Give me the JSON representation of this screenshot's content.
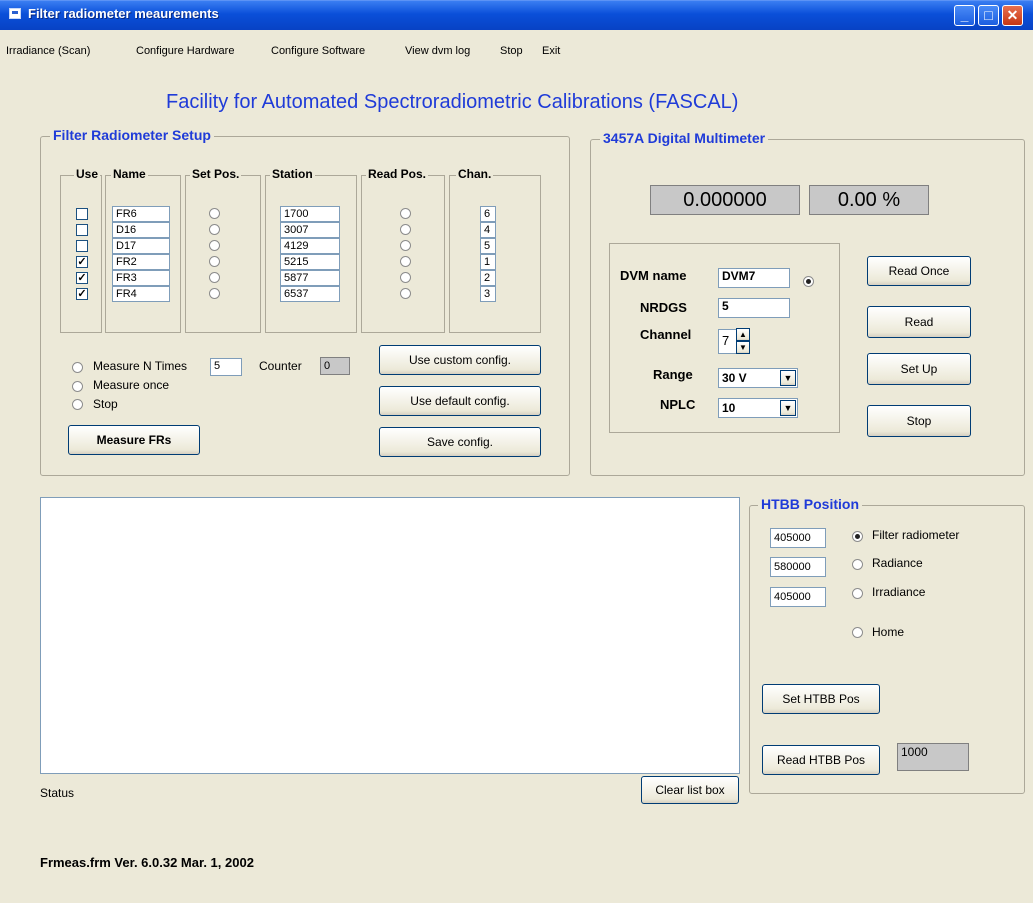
{
  "window": {
    "title": "Filter radiometer meaurements"
  },
  "menu": [
    "Irradiance (Scan)",
    "Configure Hardware",
    "Configure Software",
    "View dvm log",
    "Stop",
    "Exit"
  ],
  "main_title": "Facility for Automated Spectroradiometric Calibrations (FASCAL)",
  "fr_setup": {
    "title": "Filter Radiometer Setup",
    "headers": {
      "use": "Use",
      "name": "Name",
      "set_pos": "Set Pos.",
      "station": "Station",
      "read_pos": "Read Pos.",
      "chan": "Chan."
    },
    "rows": [
      {
        "use": false,
        "name": "FR6",
        "station": "1700",
        "chan": "6"
      },
      {
        "use": false,
        "name": "D16",
        "station": "3007",
        "chan": "4"
      },
      {
        "use": false,
        "name": "D17",
        "station": "4129",
        "chan": "5"
      },
      {
        "use": true,
        "name": "FR2",
        "station": "5215",
        "chan": "1"
      },
      {
        "use": true,
        "name": "FR3",
        "station": "5877",
        "chan": "2"
      },
      {
        "use": true,
        "name": "FR4",
        "station": "6537",
        "chan": "3"
      }
    ],
    "measure_n_label": "Measure N Times",
    "measure_n_value": "5",
    "counter_label": "Counter",
    "counter_value": "0",
    "measure_once_label": "Measure once",
    "stop_label": "Stop",
    "measure_button": "Measure FRs",
    "custom_config_button": "Use custom config.",
    "default_config_button": "Use default config.",
    "save_config_button": "Save config."
  },
  "dmm": {
    "title": "3457A Digital Multimeter",
    "reading": "0.000000",
    "percent": "0.00 %",
    "dvm_name_label": "DVM name",
    "dvm_name_value": "DVM7",
    "nrdgs_label": "NRDGS",
    "nrdgs_value": "5",
    "channel_label": "Channel",
    "channel_value": "7",
    "range_label": "Range",
    "range_value": "30 V",
    "nplc_label": "NPLC",
    "nplc_value": "10",
    "read_once_button": "Read Once",
    "read_button": "Read",
    "setup_button": "Set Up",
    "stop_button": "Stop"
  },
  "status_label": "Status",
  "clear_button": "Clear list box",
  "htbb": {
    "title": "HTBB Position",
    "pos_values": [
      "405000",
      "580000",
      "405000"
    ],
    "options": [
      "Filter radiometer",
      "Radiance",
      "Irradiance",
      "Home"
    ],
    "selected": "Filter radiometer",
    "set_button": "Set HTBB Pos",
    "read_button": "Read HTBB Pos",
    "read_value": "1000"
  },
  "footer": "Frmeas.frm  Ver. 6.0.32  Mar. 1, 2002",
  "colors": {
    "title_bar": "#0a4fd9",
    "frame_title": "#1f3bd8",
    "background": "#ece9d8"
  }
}
